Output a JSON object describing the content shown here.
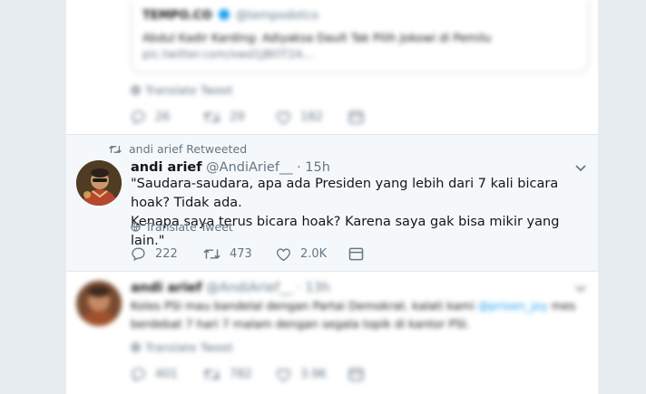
{
  "colors": {
    "page_bg": "#e6ecf0",
    "card_bg": "#ffffff",
    "highlight_bg": "#f5f8fa",
    "text_primary": "#14171a",
    "text_secondary": "#657786",
    "accent": "#1da1f2"
  },
  "top_tweet": {
    "quoted": {
      "name": "TEMPO.CO",
      "handle": "@tempodotco",
      "text": "Abdul Kadir Karding: Adiyaksa Dault Tak Pilih Jokowi di Pemilu",
      "link": "pic.twitter.com/xwd1JBOT2A..."
    },
    "translate": "Translate Tweet",
    "actions": {
      "replies": "26",
      "retweets": "29",
      "likes": "182"
    }
  },
  "main_tweet": {
    "retweeted_by": "andi arief Retweeted",
    "name": "andi arief",
    "handle": "@AndiArief__",
    "time": "· 15h",
    "text_line1": "\"Saudara-saudara, apa ada Presiden yang lebih dari 7 kali bicara hoak? Tidak ada.",
    "text_line2": "Kenapa saya terus bicara hoak? Karena saya gak bisa mikir yang lain.\"",
    "translate": "Translate Tweet",
    "actions": {
      "replies": "222",
      "retweets": "473",
      "likes": "2.0K"
    }
  },
  "bottom_tweet": {
    "name": "andi arief",
    "handle": "@AndiArief__",
    "time": "· 13h",
    "text_line1": "Koles PSI mau bandelal dengan Partai Demokrat. kalati kami",
    "mention": "@prioen_joy",
    "text_line1_end": "mes",
    "text_line2": "berdebat 7 hari 7 malam dengan segala topik di kantor PSI.",
    "translate": "Translate Tweet",
    "actions": {
      "replies": "401",
      "retweets": "782",
      "likes": "3.9K"
    }
  },
  "icons": {
    "reply": "reply-icon",
    "retweet": "retweet-icon",
    "like": "heart-icon",
    "dm": "envelope-icon",
    "globe": "globe-icon",
    "chevron": "chevron-down-icon"
  }
}
